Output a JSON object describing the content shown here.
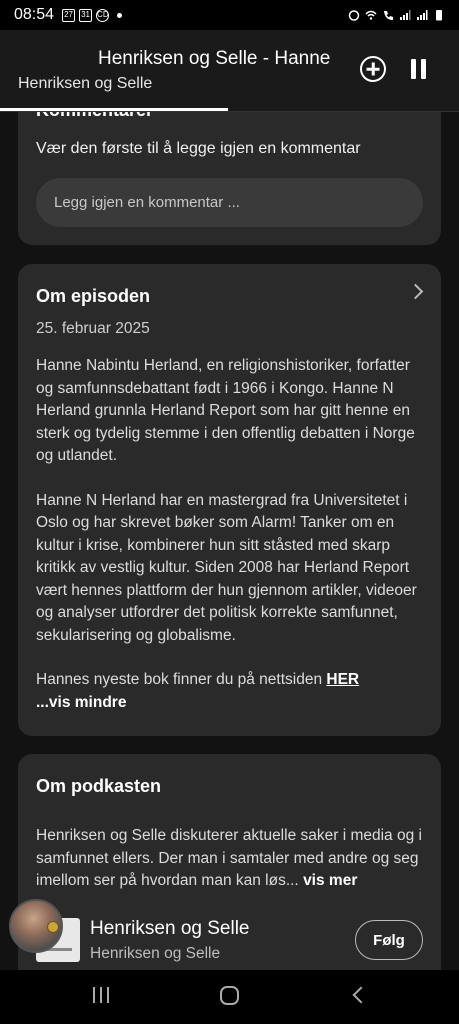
{
  "status_bar": {
    "time": "08:54",
    "notif_icons": [
      "27",
      "31",
      "CD"
    ]
  },
  "header": {
    "title": "Henriksen og Selle - Hanne",
    "subtitle": "Henriksen og Selle"
  },
  "comments": {
    "heading": "Kommentarer",
    "prompt": "Vær den første til å legge igjen en kommentar",
    "input_placeholder": "Legg igjen en kommentar ..."
  },
  "episode": {
    "heading": "Om episoden",
    "date": "25. februar 2025",
    "paragraph1": "Hanne Nabintu Herland, en religionshistoriker, forfatter og samfunnsdebattant født i 1966 i Kongo. Hanne N Herland grunnla Herland Report som har gitt henne en sterk og tydelig stemme i den offentlig debatten i Norge og utlandet.",
    "paragraph2": "Hanne N Herland har en mastergrad fra Universitetet i Oslo og har skrevet bøker som Alarm! Tanker om en kultur i krise, kombinerer hun sitt ståsted med skarp kritikk av vestlig kultur. Siden 2008 har Herland Report vært hennes plattform der hun gjennom artikler, videoer og analyser utfordrer det politisk korrekte samfunnet, sekularisering og globalisme.",
    "paragraph3_prefix": "Hannes nyeste bok finner du på nettsiden ",
    "paragraph3_link": "HER",
    "show_less": "...vis mindre"
  },
  "podcast": {
    "heading": "Om podkasten",
    "description": "Henriksen og Selle diskuterer aktuelle saker i media og i samfunnet ellers. Der man i samtaler med andre og seg imellom ser på hvordan man kan løs... ",
    "more": "vis mer"
  },
  "mini_player": {
    "name": "Henriksen og Selle",
    "subtitle": "Henriksen og Selle",
    "follow_label": "Følg"
  }
}
